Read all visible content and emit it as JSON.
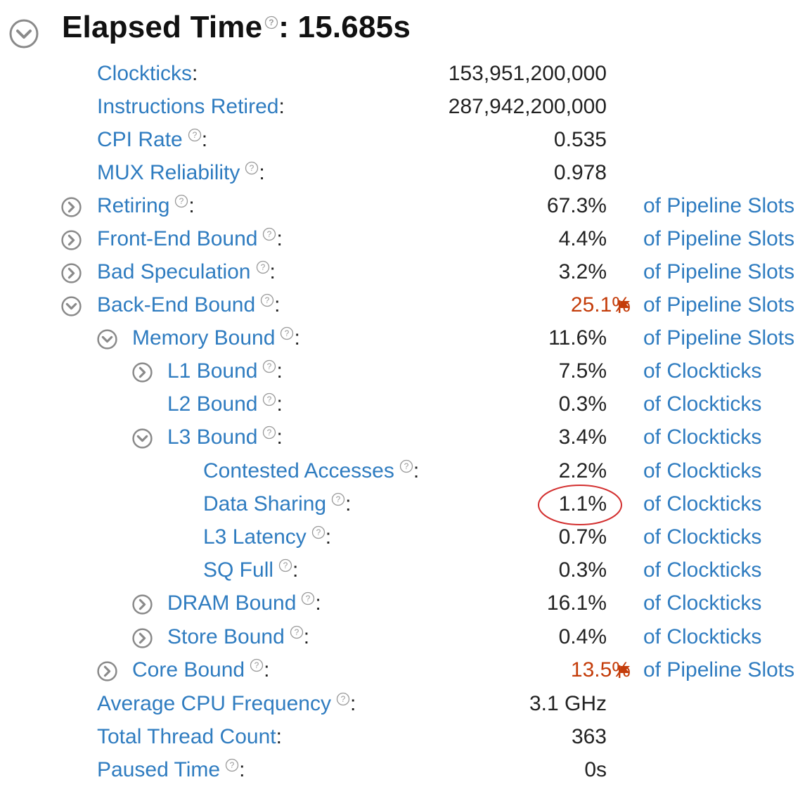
{
  "header": {
    "title_label": "Elapsed Time",
    "title_value": ": 15.685s"
  },
  "rows": [
    {
      "label": "Clockticks",
      "value": "153,951,200,000",
      "unit": ""
    },
    {
      "label": "Instructions Retired",
      "value": "287,942,200,000",
      "unit": ""
    },
    {
      "label": "CPI Rate",
      "value": "0.535",
      "unit": ""
    },
    {
      "label": "MUX Reliability",
      "value": "0.978",
      "unit": ""
    },
    {
      "label": "Retiring",
      "value": "67.3%",
      "unit": "of Pipeline Slots"
    },
    {
      "label": "Front-End Bound",
      "value": "4.4%",
      "unit": "of Pipeline Slots"
    },
    {
      "label": "Bad Speculation",
      "value": "3.2%",
      "unit": "of Pipeline Slots"
    },
    {
      "label": "Back-End Bound",
      "value": "25.1%",
      "unit": "of Pipeline Slots",
      "flagged": true
    },
    {
      "label": "Memory Bound",
      "value": "11.6%",
      "unit": "of Pipeline Slots"
    },
    {
      "label": "L1 Bound",
      "value": "7.5%",
      "unit": "of Clockticks"
    },
    {
      "label": "L2 Bound",
      "value": "0.3%",
      "unit": "of Clockticks"
    },
    {
      "label": "L3 Bound",
      "value": "3.4%",
      "unit": "of Clockticks"
    },
    {
      "label": "Contested Accesses",
      "value": "2.2%",
      "unit": "of Clockticks"
    },
    {
      "label": "Data Sharing",
      "value": "1.1%",
      "unit": "of Clockticks",
      "highlighted": true
    },
    {
      "label": "L3 Latency",
      "value": "0.7%",
      "unit": "of Clockticks"
    },
    {
      "label": "SQ Full",
      "value": "0.3%",
      "unit": "of Clockticks"
    },
    {
      "label": "DRAM Bound",
      "value": "16.1%",
      "unit": "of Clockticks"
    },
    {
      "label": "Store Bound",
      "value": "0.4%",
      "unit": "of Clockticks"
    },
    {
      "label": "Core Bound",
      "value": "13.5%",
      "unit": "of Pipeline Slots",
      "flagged": true
    },
    {
      "label": "Average CPU Frequency",
      "value": "3.1 GHz",
      "unit": ""
    },
    {
      "label": "Total Thread Count",
      "value": "363",
      "unit": ""
    },
    {
      "label": "Paused Time",
      "value": "0s",
      "unit": ""
    }
  ],
  "colors": {
    "link": "#2f7cc0",
    "flag": "#c43d0b",
    "highlight_ellipse": "#d32f2f",
    "toggle": "#8a8a8a"
  }
}
